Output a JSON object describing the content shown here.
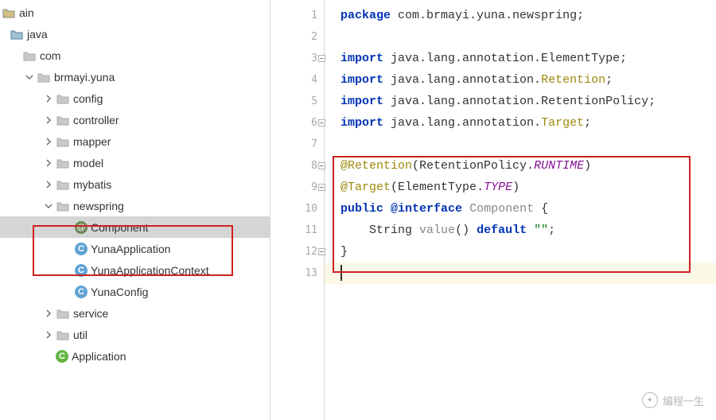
{
  "tree": {
    "main": "ain",
    "java": "java",
    "com": "com",
    "brmayi": "brmayi.yuna",
    "config": "config",
    "controller": "controller",
    "mapper": "mapper",
    "model": "model",
    "mybatis": "mybatis",
    "newspring": "newspring",
    "component": "Component",
    "yunaapp": "YunaApplication",
    "yunactx": "YunaApplicationContext",
    "yunacfg": "YunaConfig",
    "service": "service",
    "util": "util",
    "application": "Application"
  },
  "gutter": {
    "l1": "1",
    "l2": "2",
    "l3": "3",
    "l4": "4",
    "l5": "5",
    "l6": "6",
    "l7": "7",
    "l8": "8",
    "l9": "9",
    "l10": "10",
    "l11": "11",
    "l12": "12",
    "l13": "13"
  },
  "code": {
    "kw_package": "package",
    "pkg_name": "com.brmayi.yuna.newspring",
    "kw_import": "import",
    "imp1_a": "java.lang.annotation.ElementType",
    "imp2_a": "java.lang.annotation.",
    "imp2_b": "Retention",
    "imp3_a": "java.lang.annotation.RetentionPolicy",
    "imp4_a": "java.lang.annotation.",
    "imp4_b": "Target",
    "ann_ret": "@Retention",
    "retpol": "RetentionPolicy",
    "runtime": "RUNTIME",
    "ann_tgt": "@Target",
    "elemtype": "ElementType",
    "type_const": "TYPE",
    "kw_public": "public",
    "kw_interface": "@interface",
    "comp_name": "Component",
    "string_type": "String",
    "value_method": "value",
    "kw_default": "default",
    "empty_str": "\"\"",
    "brace_open": "{",
    "brace_close": "}",
    "paren_open": "(",
    "paren_close": ")",
    "dot": ".",
    "semi": ";",
    "emptyparens": "()"
  },
  "watermark": {
    "text": "编程一生"
  }
}
